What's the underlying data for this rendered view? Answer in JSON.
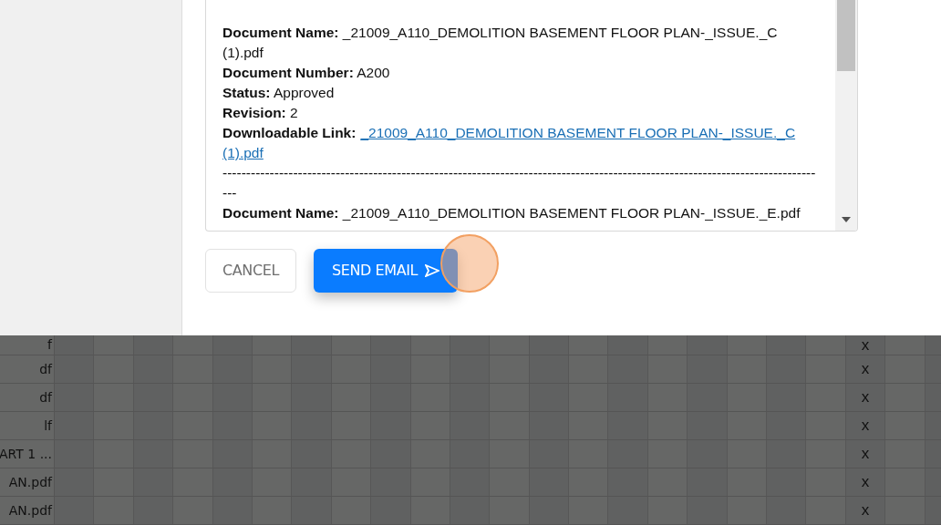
{
  "email_body": {
    "entries": [
      {
        "kind": "field",
        "label": "Document Name:",
        "value": "_21009_A110_DEMOLITION BASEMENT FLOOR PLAN-_ISSUE._C (1).pdf"
      },
      {
        "kind": "field",
        "label": "Document Number:",
        "value": "A200"
      },
      {
        "kind": "field",
        "label": "Status:",
        "value": "Approved"
      },
      {
        "kind": "field",
        "label": "Revision:",
        "value": "2"
      },
      {
        "kind": "link",
        "label": "Downloadable Link:",
        "lines": [
          "_21009_A110_DEMOLITION BASEMENT FLOOR PLAN-_ISSUE._C",
          "(1).pdf"
        ]
      },
      {
        "kind": "separator",
        "value": "---------------------------------------------------------------------------------------------------------------------------------"
      },
      {
        "kind": "field",
        "label": "Document Name:",
        "value": "_21009_A110_DEMOLITION BASEMENT FLOOR PLAN-_ISSUE._E.pdf"
      }
    ]
  },
  "buttons": [
    {
      "kind": "cancel",
      "label": "CANCEL"
    },
    {
      "kind": "send",
      "label": "SEND EMAIL"
    }
  ],
  "table": {
    "rows": [
      {
        "column_1": "f",
        "mark": "x"
      },
      {
        "column_1": "df",
        "mark": "x"
      },
      {
        "column_1": "df",
        "mark": "x"
      },
      {
        "column_1": "lf",
        "mark": "x"
      },
      {
        "column_1": "ART 1 ...",
        "mark": "x"
      },
      {
        "column_1": "AN.pdf",
        "mark": "x"
      },
      {
        "column_1": "AN.pdf",
        "mark": "x"
      }
    ]
  }
}
